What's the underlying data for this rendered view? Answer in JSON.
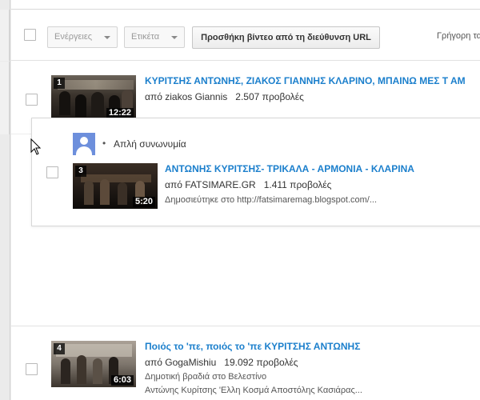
{
  "toolbar": {
    "actions_label": "Ενέργειες",
    "tags_label": "Ετικέτα",
    "add_url_label": "Προσθήκη βίντεο από τη διεύθυνση URL",
    "quick_label": "Γρήγορη τα"
  },
  "videos": [
    {
      "number": "1",
      "duration": "12:22",
      "title": "ΚΥΡΙΤΣΗΣ ΑΝΤΩΝΗΣ, ΖΙΑΚΟΣ ΓΙΑΝΝΗΣ ΚΛΑΡΙΝΟ, ΜΠΑΙΝΩ ΜΕΣ Τ ΑΜ",
      "by_prefix": "από",
      "uploader": "ziakos Giannis",
      "views": "2.507 προβολές"
    },
    {
      "number": "3",
      "duration": "5:20",
      "title": "ΑΝΤΩΝΗΣ ΚΥΡΙΤΣΗΣ- ΤΡΙΚΑΛΑ - ΑΡΜΟΝΙΑ - ΚΛΑΡΙΝΑ",
      "by_prefix": "από",
      "uploader": "FATSIMARE.GR",
      "views": "1.411 προβολές",
      "description": "Δημοσιεύτηκε στο http://fatsimaremag.blogspot.com/..."
    },
    {
      "number": "4",
      "duration": "6:03",
      "title": "Ποιός το 'πε, ποιός το 'πε ΚΥΡΙΤΣΗΣ ΑΝΤΩΝΗΣ",
      "by_prefix": "από",
      "uploader": "GogaMishiu",
      "views": "19.092 προβολές",
      "description_1": "Δημοτική βραδιά στο Βελεστίνο",
      "description_2": "Αντώνης Κυρίτσης 'Ελλη Κοσμά Αποστόλης Κασιάρας..."
    }
  ],
  "popup": {
    "bullet": "•",
    "label": "Απλή συνωνυμία"
  },
  "colors": {
    "link": "#1b7fcc",
    "avatar": "#6d8fdc"
  }
}
